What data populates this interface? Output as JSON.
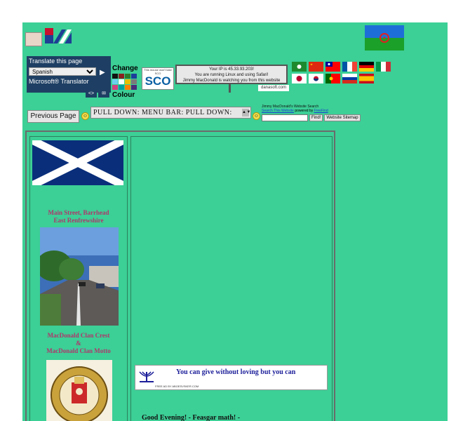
{
  "translate": {
    "title": "Translate this page",
    "selected_language": "Spanish",
    "brand": "Microsoft® Translator"
  },
  "colour_changer": {
    "top_label": "Change",
    "bottom_label": "Colour",
    "swatches": [
      "#111111",
      "#8b2020",
      "#2b7d2b",
      "#1c3d9a",
      "#6bd0f0",
      "#ffffff",
      "#e8c000",
      "#7a7a7a",
      "#d04080",
      "#00a0a0",
      "#ff8000",
      "#4a2a7a"
    ]
  },
  "sco_badge": {
    "tagline": "This mouse won't take SCO",
    "text": "SCO"
  },
  "ip_info": {
    "line1": "Your IP is 45.33.93.203!",
    "line2": "You are running Linux and using Safari!",
    "line3": "Jimmy MacDonald is watching you from this website",
    "source": "danasoft.com"
  },
  "nav": {
    "previous_page_label": "Previous Page",
    "pulldown_label": "PULL DOWN: MENU BAR: PULL DOWN:"
  },
  "search": {
    "title": "Jimmy MacDonald's Website Search",
    "link_text": "Search This Website",
    "powered_by": "powered by",
    "provider": "FreeFind",
    "find_label": "Find!",
    "sitemap_label": "Website Sitemap"
  },
  "sidebar": {
    "caption1_line1": "Main Street, Barrhead",
    "caption1_line2": "East Renfrewshire",
    "caption2_line1": "MacDonald Clan Crest",
    "caption2_line2": "&",
    "caption2_line3": "MacDonald Clan Motto"
  },
  "main": {
    "motto_text": "You can give without loving but you can",
    "motto_credit": "FREE AD BY ABOESVSKER.COM",
    "greeting": "Good Evening! - Feasgar math! -"
  },
  "colors": {
    "page_background": "#3ccf96",
    "translate_panel": "#1e3f63",
    "caption_color": "#b0356b",
    "motto_color": "#1d1f9a"
  }
}
